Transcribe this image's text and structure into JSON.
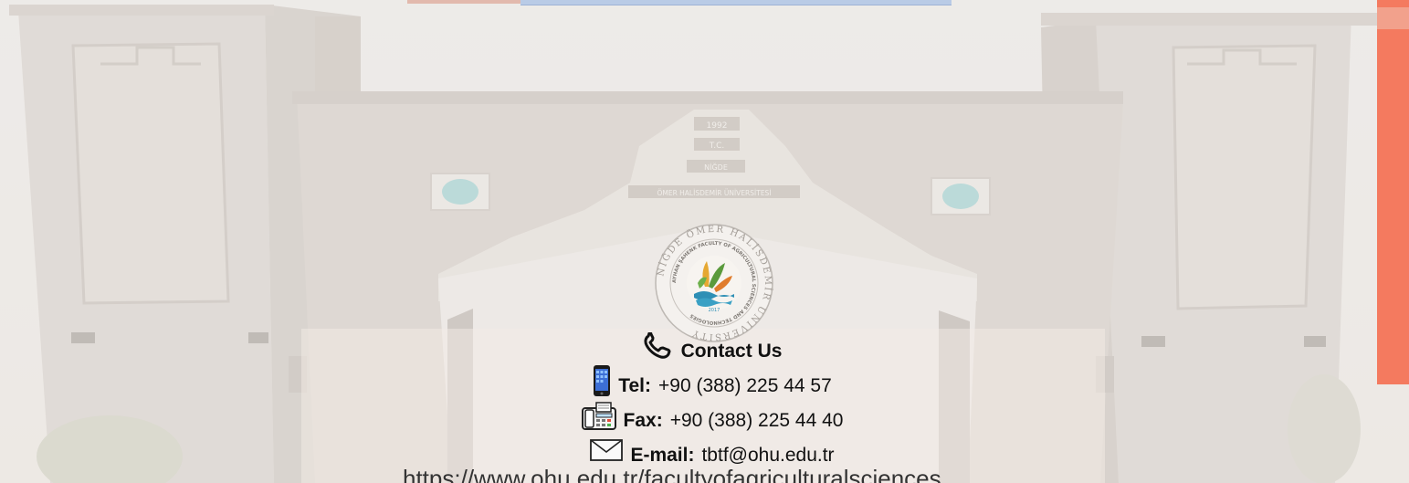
{
  "contact": {
    "title": "Contact Us",
    "tel_label": "Tel:",
    "tel_value": "+90 (388) 225 44 57",
    "fax_label": "Fax:",
    "fax_value": "+90 (388) 225 44 40",
    "email_label": "E-mail:",
    "email_value": "tbtf@ohu.edu.tr"
  },
  "website": {
    "url": "https://www.ohu.edu.tr/facultyofagriculturalsciences"
  },
  "building": {
    "plaque_year": "1992",
    "plaque_tc": "T.C.",
    "plaque_city": "NİĞDE",
    "plaque_university": "ÖMER HALİSDEMİR ÜNİVERSİTESİ"
  },
  "logo": {
    "outer_text": "NİĞDE ÖMER HALİSDEMİR UNIVERSITY",
    "inner_text": "AYHAN ŞAHENK FACULTY OF AGRICULTURAL SCIENCES AND TECHNOLOGIES",
    "year": "2017"
  },
  "icons": {
    "contact": "phone-handset-icon",
    "tel": "mobile-phone-icon",
    "fax": "fax-machine-icon",
    "email": "envelope-icon"
  },
  "colors": {
    "accent": "#f47a5f",
    "top_bar_blue": "#b9cbe6",
    "top_bar_red": "#e2b9ad"
  }
}
